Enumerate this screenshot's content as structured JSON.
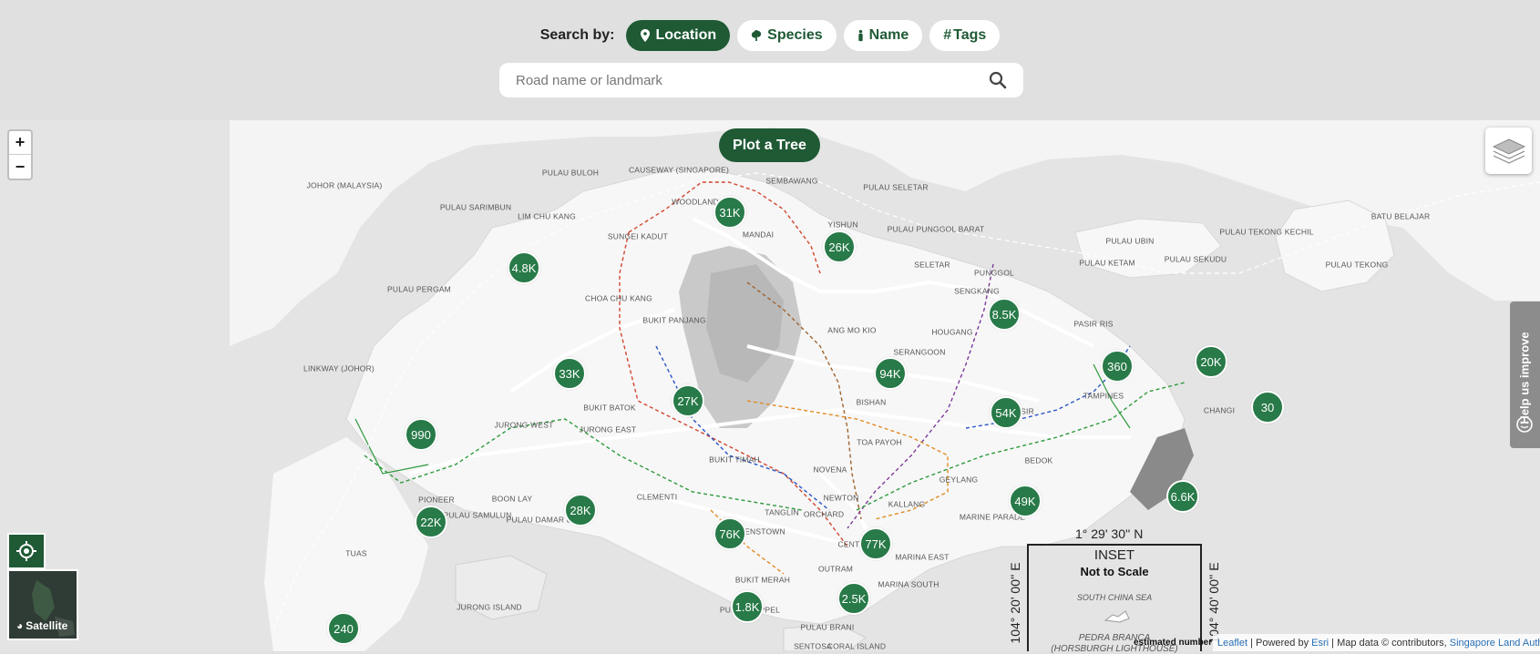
{
  "search": {
    "label": "Search by:",
    "modes": [
      {
        "label": "Location",
        "icon": "map-pin-icon",
        "active": true
      },
      {
        "label": "Species",
        "icon": "tree-icon",
        "active": false
      },
      {
        "label": "Name",
        "icon": "person-icon",
        "active": false
      },
      {
        "label": "Tags",
        "icon": "hash-icon",
        "active": false
      }
    ],
    "placeholder": "Road name or landmark"
  },
  "map": {
    "plot_button": "Plot a Tree",
    "zoom_in": "+",
    "zoom_out": "−",
    "satellite_label": "Satellite",
    "help_label": "Help us improve",
    "estimated": "estimated number",
    "attribution": {
      "leaflet": "Leaflet",
      "powered": " | Powered by ",
      "esri": "Esri",
      "mapdata": " | Map data © contributors, ",
      "sla": "Singapore Land Authority"
    },
    "inset": {
      "coord_top": "1° 29' 30'' N",
      "coord_left": "104° 20' 00'' E",
      "coord_right": "104° 40' 00'' E",
      "title": "INSET",
      "subtitle": "Not to Scale",
      "sea": "SOUTH CHINA SEA",
      "pedra": "PEDRA BRANCA",
      "lighthouse": "(HORSBURGH LIGHTHOUSE)"
    },
    "clusters": [
      "31K",
      "26K",
      "4.8K",
      "8.5K",
      "33K",
      "94K",
      "360",
      "20K",
      "27K",
      "54K",
      "30",
      "990",
      "49K",
      "6.6K",
      "22K",
      "28K",
      "76K",
      "77K",
      "2.5K",
      "1.8K",
      "240"
    ],
    "places": [
      "JOHOR (MALAYSIA)",
      "PULAU BULOH",
      "CAUSEWAY (SINGAPORE)",
      "SEMBAWANG",
      "PULAU SELETAR",
      "PULAU SARIMBUN",
      "LIM CHU KANG",
      "WOODLANDS",
      "YISHUN",
      "MANDAI",
      "PULAU PUNGGOL BARAT",
      "SUNGEI KADUT",
      "SELETAR",
      "PULAU UBIN",
      "PULAU TEKONG KECHIL",
      "BATU BELAJAR",
      "PULAU PERGAM",
      "PUNGGOL",
      "PULAU KETAM",
      "PULAU SEKUDU",
      "PULAU TEKONG",
      "SENGKANG",
      "CHOA CHU KANG",
      "ANG MO KIO",
      "HOUGANG",
      "PASIR RIS",
      "BUKIT PANJANG",
      "SERANGOON",
      "LINKWAY (JOHOR)",
      "BUKIT BATOK",
      "BISHAN",
      "TAMPINES",
      "CHANGI",
      "PASIR",
      "JURONG WEST",
      "JURONG EAST",
      "TOA PAYOH",
      "BUKIT TIMAH",
      "BEDOK",
      "NOVENA",
      "GEYLANG",
      "PIONEER",
      "BOON LAY",
      "CLEMENTI",
      "NEWTON",
      "PULAU SAMULUN",
      "PULAU DAMAR LAUT",
      "TANGLIN",
      "ORCHARD",
      "KALLANG",
      "MARINE PARADE",
      "QUEENSTOWN",
      "CENTRAL",
      "TUAS",
      "MARINA EAST",
      "OUTRAM",
      "BUKIT MERAH",
      "MARINA SOUTH",
      "JURONG ISLAND",
      "PULAU KEPPEL",
      "PULAU BRANI",
      "SENTOSA",
      "CORAL ISLAND"
    ]
  }
}
